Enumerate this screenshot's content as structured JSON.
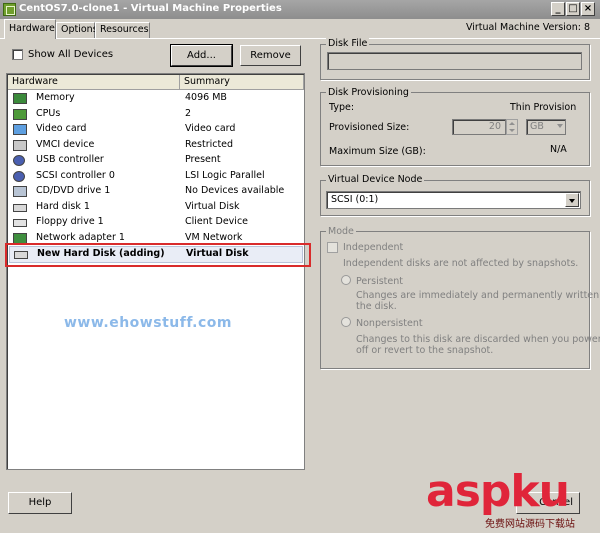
{
  "window": {
    "title": "CentOS7.0-clone1 - Virtual Machine Properties",
    "version_label": "Virtual Machine Version: 8"
  },
  "tabs": [
    {
      "label": "Hardware"
    },
    {
      "label": "Options"
    },
    {
      "label": "Resources"
    }
  ],
  "left": {
    "show_all_devices": "Show All Devices",
    "add_button": "Add...",
    "remove_button": "Remove",
    "columns": {
      "hardware": "Hardware",
      "summary": "Summary"
    },
    "rows": [
      {
        "name": "Memory",
        "summary": "4096 MB",
        "icon": "memory-icon"
      },
      {
        "name": "CPUs",
        "summary": "2",
        "icon": "cpu-icon"
      },
      {
        "name": "Video card",
        "summary": "Video card",
        "icon": "monitor-icon"
      },
      {
        "name": "VMCI device",
        "summary": "Restricted",
        "icon": "vmci-icon"
      },
      {
        "name": "USB controller",
        "summary": "Present",
        "icon": "usb-icon"
      },
      {
        "name": "SCSI controller 0",
        "summary": "LSI Logic Parallel",
        "icon": "scsi-icon"
      },
      {
        "name": "CD/DVD drive 1",
        "summary": "No Devices available",
        "icon": "cd-icon"
      },
      {
        "name": "Hard disk 1",
        "summary": "Virtual Disk",
        "icon": "disk-icon"
      },
      {
        "name": "Floppy drive 1",
        "summary": "Client Device",
        "icon": "floppy-icon"
      },
      {
        "name": "Network adapter 1",
        "summary": "VM Network",
        "icon": "network-icon"
      },
      {
        "name": "New Hard Disk (adding)",
        "summary": "Virtual Disk",
        "icon": "disk-icon"
      }
    ],
    "help_button": "Help"
  },
  "watermark": "www.ehowstuff.com",
  "disk_file": {
    "legend": "Disk File",
    "value": ""
  },
  "provisioning": {
    "legend": "Disk Provisioning",
    "type_label": "Type:",
    "type_value": "Thin Provision",
    "size_label": "Provisioned Size:",
    "size_value": "20",
    "size_unit": "GB",
    "max_label": "Maximum Size (GB):",
    "max_value": "N/A"
  },
  "vdn": {
    "legend": "Virtual Device Node",
    "selected": "SCSI (0:1)"
  },
  "mode": {
    "legend": "Mode",
    "independent": "Independent",
    "independent_desc": "Independent disks are not affected by snapshots.",
    "persistent": "Persistent",
    "persistent_desc_1": "Changes are immediately and permanently written to",
    "persistent_desc_2": "the disk.",
    "nonpersistent": "Nonpersistent",
    "nonpersistent_desc_1": "Changes to this disk are discarded when you power",
    "nonpersistent_desc_2": "off or revert to the snapshot."
  },
  "footer": {
    "cancel_label": "Cancel"
  },
  "brand": {
    "logo": "aspku",
    "tagline": "免费网站源码下载站"
  },
  "colors": {
    "highlight": "#d92b2b",
    "titlebar": "#8d8d8d",
    "logo": "#e0253a"
  }
}
